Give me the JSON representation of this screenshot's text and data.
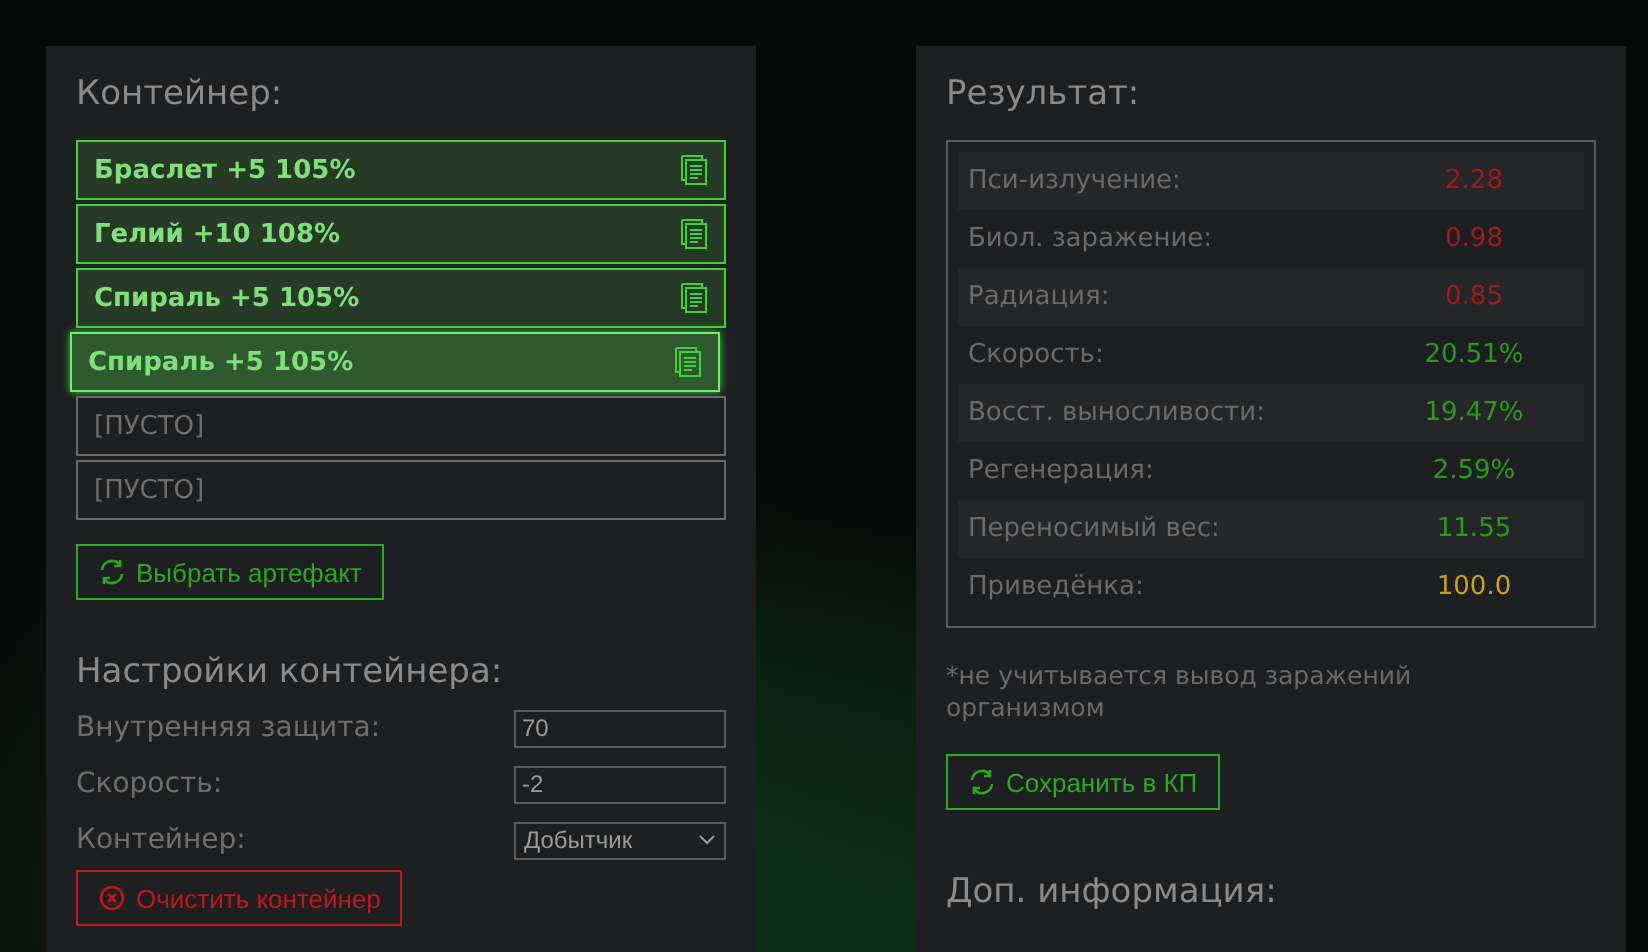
{
  "container": {
    "title": "Контейнер:",
    "slots": [
      {
        "kind": "artifact",
        "label": "Браслет +5 105%",
        "selected": false
      },
      {
        "kind": "artifact",
        "label": "Гелий +10 108%",
        "selected": false
      },
      {
        "kind": "artifact",
        "label": "Спираль +5 105%",
        "selected": false
      },
      {
        "kind": "artifact",
        "label": "Спираль +5 105%",
        "selected": true
      },
      {
        "kind": "empty",
        "label": "[ПУСТО]",
        "selected": false
      },
      {
        "kind": "empty",
        "label": "[ПУСТО]",
        "selected": false
      }
    ],
    "pick_button": "Выбрать артефакт"
  },
  "settings": {
    "title": "Настройки контейнера:",
    "fields": [
      {
        "kind": "input",
        "label": "Внутренняя защита:",
        "value": "70"
      },
      {
        "kind": "input",
        "label": "Скорость:",
        "value": "-2"
      },
      {
        "kind": "select",
        "label": "Контейнер:",
        "value": "Добытчик"
      }
    ],
    "clear_button": "Очистить контейнер"
  },
  "result": {
    "title": "Результат:",
    "rows": [
      {
        "label": "Пси-излучение:",
        "value": "2.28",
        "color": "#a01c1c"
      },
      {
        "label": "Биол. заражение:",
        "value": "0.98",
        "color": "#a01c1c"
      },
      {
        "label": "Радиация:",
        "value": "0.85",
        "color": "#a01c1c"
      },
      {
        "label": "Скорость:",
        "value": "20.51%",
        "color": "#2a9a1a"
      },
      {
        "label": "Восст. выносливости:",
        "value": "19.47%",
        "color": "#2a9a1a"
      },
      {
        "label": "Регенерация:",
        "value": "2.59%",
        "color": "#2a9a1a"
      },
      {
        "label": "Переносимый вес:",
        "value": "11.55",
        "color": "#2a9a1a"
      },
      {
        "label": "Приведёнка:",
        "value": "100.0",
        "color": "#c9a21a"
      }
    ],
    "note": "*не учитывается вывод заражений организмом",
    "save_button": "Сохранить в КП"
  },
  "extra": {
    "title": "Доп. информация:"
  }
}
